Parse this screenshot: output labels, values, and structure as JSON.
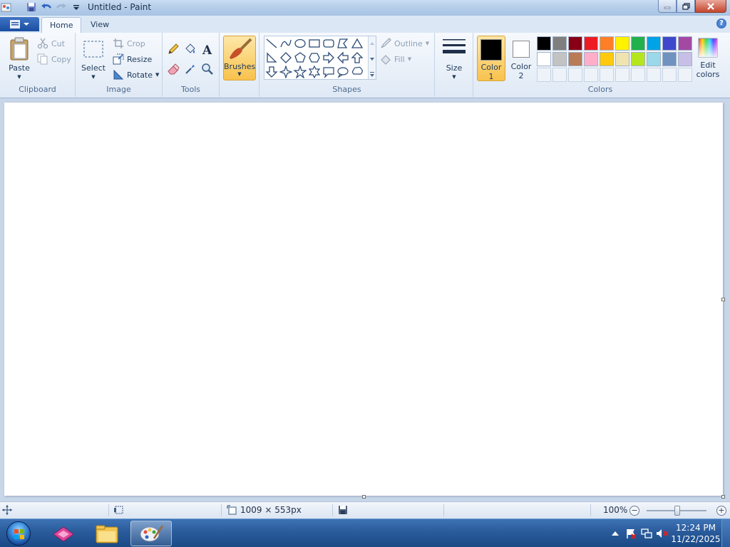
{
  "window": {
    "title": "Untitled - Paint"
  },
  "tabs": [
    {
      "label": "Home"
    },
    {
      "label": "View"
    }
  ],
  "help": {
    "label": "?"
  },
  "ribbon": {
    "clipboard": {
      "label": "Clipboard",
      "paste": "Paste",
      "cut": "Cut",
      "copy": "Copy"
    },
    "image": {
      "label": "Image",
      "select": "Select",
      "crop": "Crop",
      "resize": "Resize",
      "rotate": "Rotate"
    },
    "tools": {
      "label": "Tools",
      "items": [
        "pencil-icon",
        "fill-bucket-icon",
        "text-icon",
        "eraser-icon",
        "color-picker-icon",
        "magnifier-icon"
      ]
    },
    "brushes": {
      "label": "Brushes"
    },
    "shapes": {
      "label": "Shapes",
      "outline": "Outline",
      "fill": "Fill"
    },
    "size": {
      "label": "Size"
    },
    "colors": {
      "label": "Colors",
      "color1_line1": "Color",
      "color1_line2": "1",
      "color2_line1": "Color",
      "color2_line2": "2",
      "edit_line1": "Edit",
      "edit_line2": "colors",
      "color1": "#000000",
      "color2": "#ffffff",
      "row1": [
        "#000000",
        "#7f7f7f",
        "#880015",
        "#ed1c24",
        "#ff7f27",
        "#fff200",
        "#22b14c",
        "#00a2e8",
        "#3f48cc",
        "#a349a4"
      ],
      "row2": [
        "#ffffff",
        "#c3c3c3",
        "#b97a57",
        "#ffaec9",
        "#ffc90e",
        "#efe4b0",
        "#b5e61d",
        "#99d9ea",
        "#7092be",
        "#c8bfe7"
      ]
    }
  },
  "status": {
    "dimensions": "1009 × 553px",
    "zoom": "100%"
  },
  "taskbar": {
    "time": "12:24 PM",
    "date": "11/22/2025"
  }
}
